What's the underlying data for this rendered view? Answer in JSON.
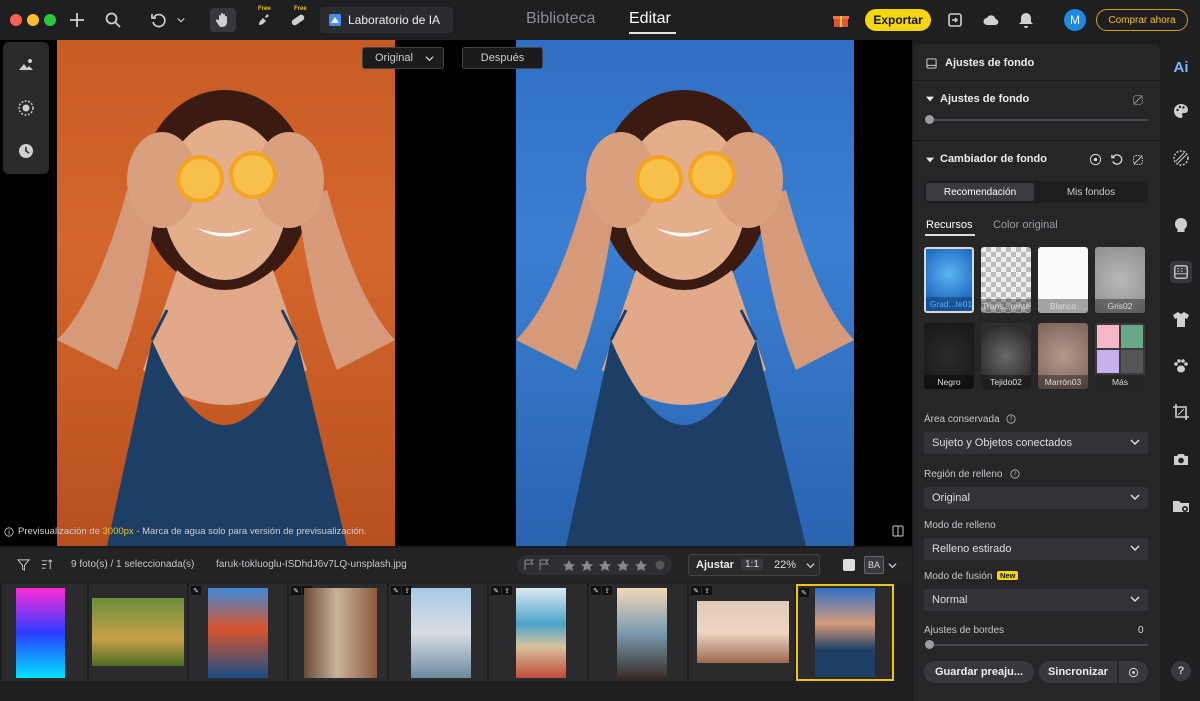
{
  "topbar": {
    "ai_lab_label": "Laboratorio de IA",
    "free_tag": "Free",
    "tab_library": "Biblioteca",
    "tab_edit": "Editar",
    "export_label": "Exportar",
    "avatar_initial": "M",
    "buy_label": "Comprar ahora"
  },
  "canvas": {
    "compare_before": "Original",
    "compare_after": "Después",
    "preview_note_prefix": "Previsualización de ",
    "preview_note_size": "3000px",
    "preview_note_suffix": " - Marca de agua solo para versión de previsualización."
  },
  "filmbar": {
    "selection_count": "9 foto(s) / 1 seleccionada(s)",
    "filename": "faruk-tokluoglu-ISDhdJ6v7LQ-unsplash.jpg",
    "fit_label": "Ajustar",
    "one_to_one": "1:1",
    "zoom": "22%",
    "ba_label": "BA"
  },
  "panel": {
    "header_title": "Ajustes de fondo",
    "section_bg_title": "Ajustes de fondo",
    "section_changer_title": "Cambiador de fondo",
    "seg_recommend": "Recomendación",
    "seg_my_bgs": "Mis fondos",
    "subtab_resources": "Recursos",
    "subtab_original_color": "Color original",
    "swatches": [
      {
        "label": "Grad...te01",
        "selected": true
      },
      {
        "label": "Trans...rente"
      },
      {
        "label": "Blanco"
      },
      {
        "label": "Gris02"
      },
      {
        "label": "Negro"
      },
      {
        "label": "Tejido02"
      },
      {
        "label": "Marrón03"
      },
      {
        "label": "Más"
      }
    ],
    "area_label": "Área conservada",
    "area_value": "Sujeto y Objetos conectados",
    "fill_region_label": "Región de relleno",
    "fill_region_value": "Original",
    "fill_mode_label": "Modo de relleno",
    "fill_mode_value": "Relleno estirado",
    "blend_mode_label": "Modo de fusión",
    "new_badge": "New",
    "blend_mode_value": "Normal",
    "edge_label": "Ajustes de bordes",
    "edge_value": "0",
    "save_preset": "Guardar preaju...",
    "sync": "Sincronizar"
  },
  "rightbar": {
    "ai_label": "Ai",
    "help": "?"
  },
  "colors": {
    "accent_yellow": "#f5d60f",
    "avatar_blue": "#1e88e5",
    "selected_border": "#f0c419"
  }
}
